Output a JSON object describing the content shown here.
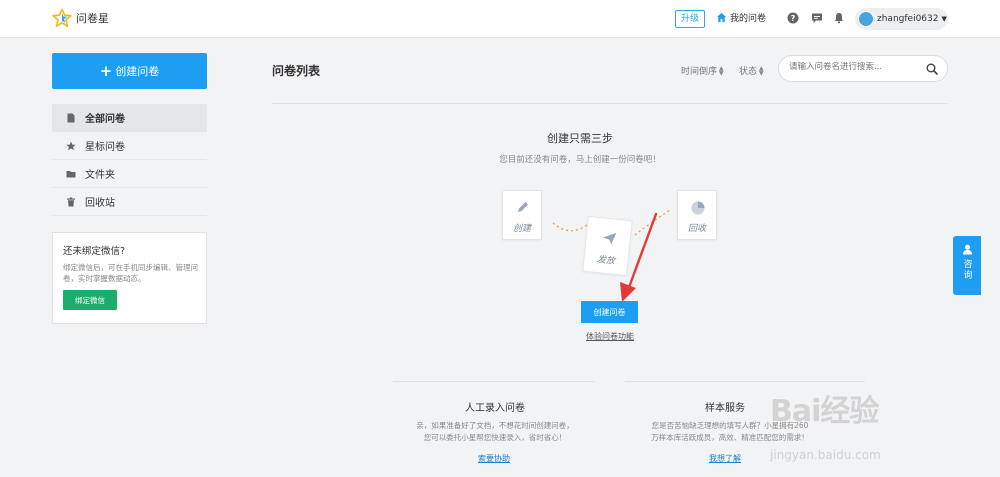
{
  "header": {
    "app_name": "问卷星",
    "upgrade_label": "升级",
    "my_surveys_label": "我的问卷",
    "username": "zhangfei0632"
  },
  "sidebar": {
    "create_label": "创建问卷",
    "items": [
      {
        "label": "全部问卷",
        "icon": "document-icon",
        "active": true
      },
      {
        "label": "星标问卷",
        "icon": "star-icon",
        "active": false
      },
      {
        "label": "文件夹",
        "icon": "folder-icon",
        "active": false
      },
      {
        "label": "回收站",
        "icon": "trash-icon",
        "active": false
      }
    ],
    "wechat": {
      "title": "还未绑定微信?",
      "description": "绑定微信后，可在手机同步编辑、管理问卷，实时掌握数据动态。",
      "button_label": "绑定微信"
    }
  },
  "main": {
    "title": "问卷列表",
    "sort_time_label": "时间倒序",
    "sort_status_label": "状态",
    "search_placeholder": "请输入问卷名进行搜索...",
    "empty_title": "创建只需三步",
    "empty_subtitle": "您目前还没有问卷，马上创建一份问卷吧！",
    "steps": {
      "create": "创建",
      "publish": "发放",
      "collect": "回收"
    },
    "create_button_label": "创建问卷",
    "experience_link": "体验问卷功能",
    "services": [
      {
        "title": "人工录入问卷",
        "description_line1": "亲，如果准备好了文档，不想花时间创建问卷，",
        "description_line2": "您可以委托小星帮您快速录入，省时省心！",
        "link": "索要协助"
      },
      {
        "title": "样本服务",
        "description_line1": "您是否苦恼缺乏理想的填写人群？小星拥有260",
        "description_line2": "万样本库活跃成员，高效、精准匹配您的需求！",
        "link": "我想了解"
      }
    ]
  },
  "side_float": {
    "label": "咨询"
  },
  "watermark": {
    "brand": "Bai经验",
    "url": "jingyan.baidu.com"
  },
  "colors": {
    "primary": "#1e9ef3",
    "wechat_green": "#1aad6b",
    "arrow_red": "#e53935"
  }
}
